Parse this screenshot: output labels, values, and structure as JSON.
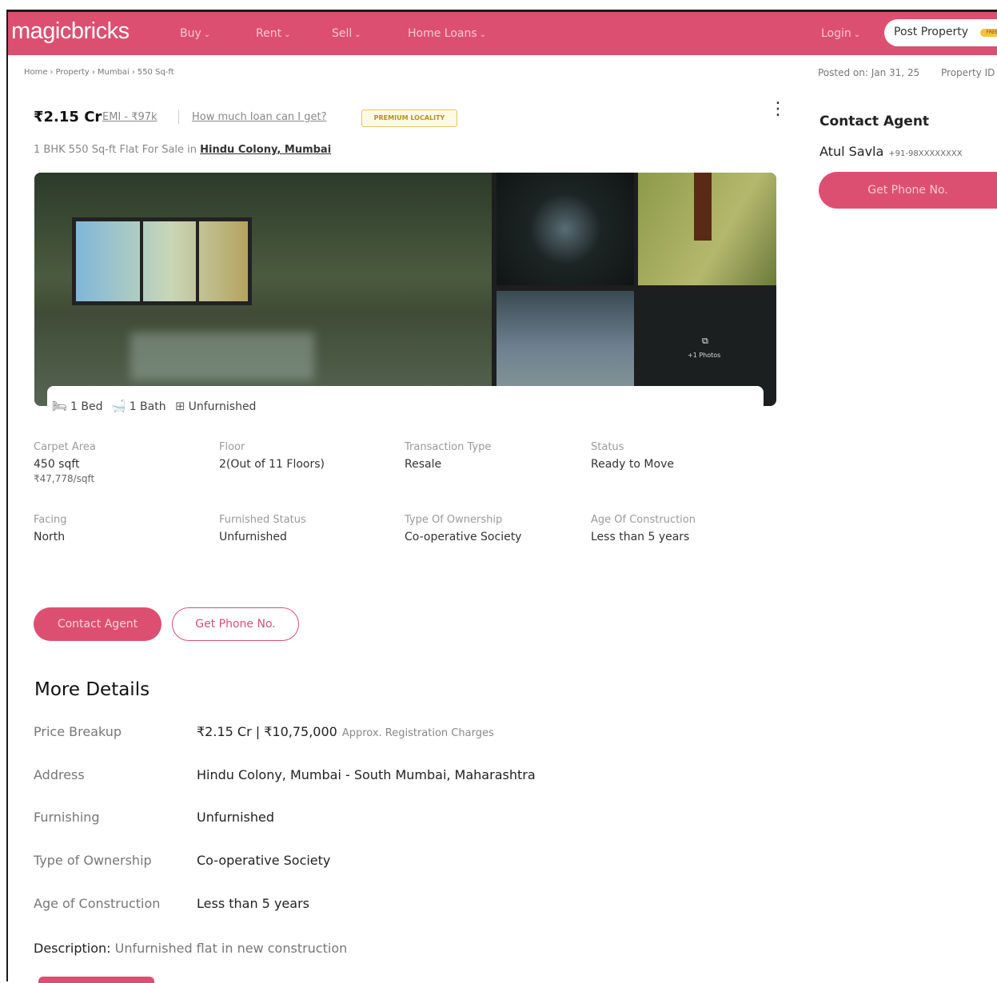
{
  "header": {
    "logo": "magicbricks",
    "nav": [
      {
        "label": "Buy"
      },
      {
        "label": "Rent"
      },
      {
        "label": "Sell"
      },
      {
        "label": "Home Loans"
      }
    ],
    "login_label": "Login",
    "post_property_label": "Post Property",
    "post_property_badge": "FREE"
  },
  "breadcrumb": [
    "Home",
    "Property",
    "Mumbai",
    "550 Sq-ft"
  ],
  "posted_on": "Posted on: Jan 31, 25",
  "property_id_label": "Property ID",
  "listing": {
    "price": "₹2.15 Cr",
    "emi": "EMI - ₹97k",
    "loan_link": "How much loan can I get?",
    "badge": "PREMIUM LOCALITY",
    "subtitle_prefix": "1 BHK 550 Sq-ft Flat For Sale in",
    "location": "Hindu Colony, Mumbai"
  },
  "gallery": {
    "more_photos": "+1 Photos"
  },
  "features": {
    "bed": "1 Bed",
    "bath": "1 Bath",
    "furnishing": "Unfurnished"
  },
  "specs": [
    {
      "label": "Carpet Area",
      "value": "450 sqft",
      "sub": "₹47,778/sqft"
    },
    {
      "label": "Floor",
      "value": "2(Out of 11 Floors)"
    },
    {
      "label": "Transaction Type",
      "value": "Resale"
    },
    {
      "label": "Status",
      "value": "Ready to Move"
    },
    {
      "label": "Facing",
      "value": "North"
    },
    {
      "label": "Furnished Status",
      "value": "Unfurnished"
    },
    {
      "label": "Type Of Ownership",
      "value": "Co-operative Society"
    },
    {
      "label": "Age Of Construction",
      "value": "Less than 5 years"
    }
  ],
  "actions": {
    "contact_agent": "Contact Agent",
    "get_phone": "Get Phone No."
  },
  "more_details": {
    "title": "More Details",
    "rows": [
      {
        "key": "Price Breakup",
        "value": "₹2.15 Cr | ₹10,75,000",
        "note": "Approx. Registration Charges"
      },
      {
        "key": "Address",
        "value": "Hindu Colony, Mumbai - South Mumbai, Maharashtra"
      },
      {
        "key": "Furnishing",
        "value": "Unfurnished"
      },
      {
        "key": "Type of Ownership",
        "value": "Co-operative Society"
      },
      {
        "key": "Age of Construction",
        "value": "Less than 5 years"
      }
    ],
    "description_label": "Description:",
    "description": "Unfurnished flat in new construction"
  },
  "sidebar": {
    "title": "Contact Agent",
    "agent_name": "Atul Savla",
    "agent_phone": "+91-98XXXXXXXX",
    "get_phone": "Get Phone No."
  },
  "colors": {
    "brand": "#dd4f70",
    "badge_border": "#e6c25a"
  }
}
